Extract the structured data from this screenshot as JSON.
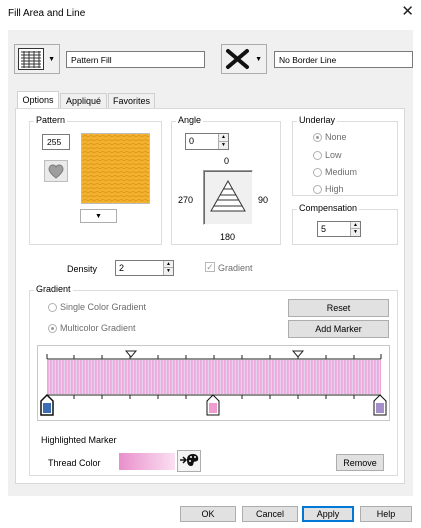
{
  "window": {
    "title": "Fill Area and Line",
    "close_glyph": "✕"
  },
  "fill_type": {
    "value": "Pattern Fill"
  },
  "line_type": {
    "value": "No Border Line"
  },
  "tabs": [
    {
      "label": "Options",
      "active": true
    },
    {
      "label": "Appliqué",
      "active": false
    },
    {
      "label": "Favorites",
      "active": false
    }
  ],
  "pattern": {
    "label": "Pattern",
    "number": "255",
    "swatch_color": "#F2B02C"
  },
  "angle": {
    "label": "Angle",
    "value": "0",
    "compass": {
      "top": "0",
      "left": "270",
      "right": "90",
      "bottom": "180"
    }
  },
  "underlay": {
    "label": "Underlay",
    "options": [
      {
        "label": "None",
        "selected": true
      },
      {
        "label": "Low",
        "selected": false
      },
      {
        "label": "Medium",
        "selected": false
      },
      {
        "label": "High",
        "selected": false
      }
    ]
  },
  "compensation": {
    "label": "Compensation",
    "value": "5"
  },
  "density": {
    "label": "Density",
    "value": "2"
  },
  "gradient_check": {
    "label": "Gradient",
    "checked": true
  },
  "gradient": {
    "label": "Gradient",
    "single_label": "Single Color Gradient",
    "multi_label": "Multicolor Gradient",
    "multi_selected": true,
    "reset_label": "Reset",
    "add_marker_label": "Add Marker",
    "stops": [
      "#3A6FB3",
      "#F2A6D4",
      "#A58FCB"
    ],
    "marker_colors": [
      "#3A6FB3",
      "#F29BD1",
      "#A58FCB"
    ]
  },
  "highlighted_marker": {
    "label": "Highlighted Marker",
    "thread_color_label": "Thread Color",
    "remove_label": "Remove",
    "color_from": "#E98FCC",
    "color_to": "#FBE0F2"
  },
  "footer": {
    "ok": "OK",
    "cancel": "Cancel",
    "apply": "Apply",
    "help": "Help"
  },
  "colors": {
    "accent": "#0078D7",
    "pattern": "#F2B02C",
    "gradient_pink": "#F2A6D4"
  }
}
